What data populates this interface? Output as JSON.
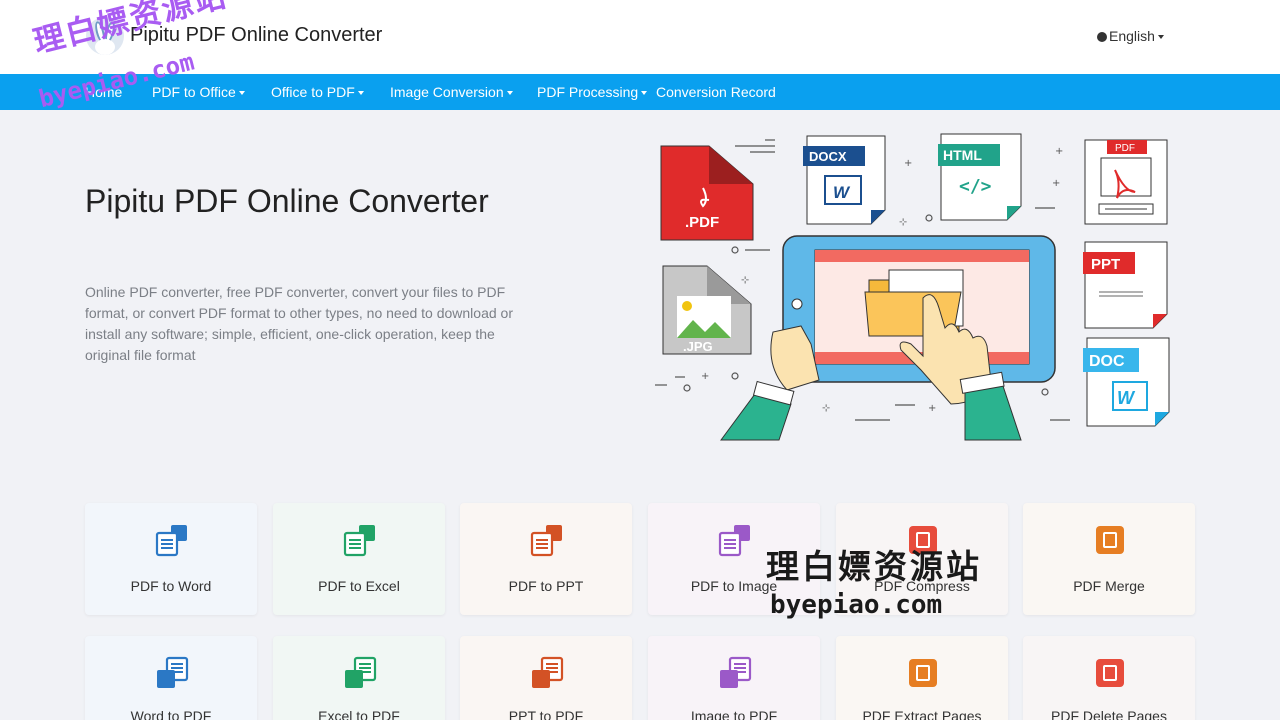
{
  "header": {
    "site_title": "Pipitu PDF Online Converter",
    "language": "English"
  },
  "nav": {
    "items": [
      {
        "label": "Home",
        "dropdown": false
      },
      {
        "label": "PDF to Office",
        "dropdown": true
      },
      {
        "label": "Office to PDF",
        "dropdown": true
      },
      {
        "label": "Image Conversion",
        "dropdown": true
      },
      {
        "label": "PDF Processing",
        "dropdown": true
      },
      {
        "label": "Conversion Record",
        "dropdown": false
      }
    ]
  },
  "hero": {
    "title": "Pipitu PDF Online Converter",
    "description": "Online PDF converter, free PDF converter, convert your files to PDF format, or convert PDF format to other types, no need to download or install any software; simple, efficient, one-click operation, keep the original file format",
    "illustration_labels": {
      "pdf": ".PDF",
      "docx": "DOCX",
      "html": "HTML",
      "pdf_small": "PDF",
      "jpg": ".JPG",
      "ppt": "PPT",
      "doc": "DOC"
    }
  },
  "watermarks": {
    "cn": "理白嫖资源站",
    "url": "byepiao.com"
  },
  "tools": [
    {
      "label": "PDF to Word",
      "icon": "pdf-to-word-icon",
      "color": "#2b78c5",
      "bg": "#f2f6fb"
    },
    {
      "label": "PDF to Excel",
      "icon": "pdf-to-excel-icon",
      "color": "#21a366",
      "bg": "#f1f7f4"
    },
    {
      "label": "PDF to PPT",
      "icon": "pdf-to-ppt-icon",
      "color": "#d35225",
      "bg": "#faf6f3"
    },
    {
      "label": "PDF to Image",
      "icon": "pdf-to-image-icon",
      "color": "#9b59c8",
      "bg": "#f8f3f8"
    },
    {
      "label": "PDF Compress",
      "icon": "pdf-compress-icon",
      "color": "#e74c3c",
      "bg": "#f8f5f5"
    },
    {
      "label": "PDF Merge",
      "icon": "pdf-merge-icon",
      "color": "#e67e22",
      "bg": "#faf7f3"
    },
    {
      "label": "Word to PDF",
      "icon": "word-to-pdf-icon",
      "color": "#2b78c5",
      "bg": "#f2f6fb"
    },
    {
      "label": "Excel to PDF",
      "icon": "excel-to-pdf-icon",
      "color": "#21a366",
      "bg": "#f1f7f4"
    },
    {
      "label": "PPT to PDF",
      "icon": "ppt-to-pdf-icon",
      "color": "#d35225",
      "bg": "#faf6f3"
    },
    {
      "label": "Image to PDF",
      "icon": "image-to-pdf-icon",
      "color": "#9b59c8",
      "bg": "#f8f3f8"
    },
    {
      "label": "PDF Extract Pages",
      "icon": "pdf-extract-pages-icon",
      "color": "#e67e22",
      "bg": "#faf7f3"
    },
    {
      "label": "PDF Delete Pages",
      "icon": "pdf-delete-pages-icon",
      "color": "#e74c3c",
      "bg": "#f8f5f5"
    }
  ],
  "colors": {
    "nav_bg": "#0aa0ef",
    "page_bg": "#f1f2f6",
    "watermark_purple": "#a95cf2"
  }
}
